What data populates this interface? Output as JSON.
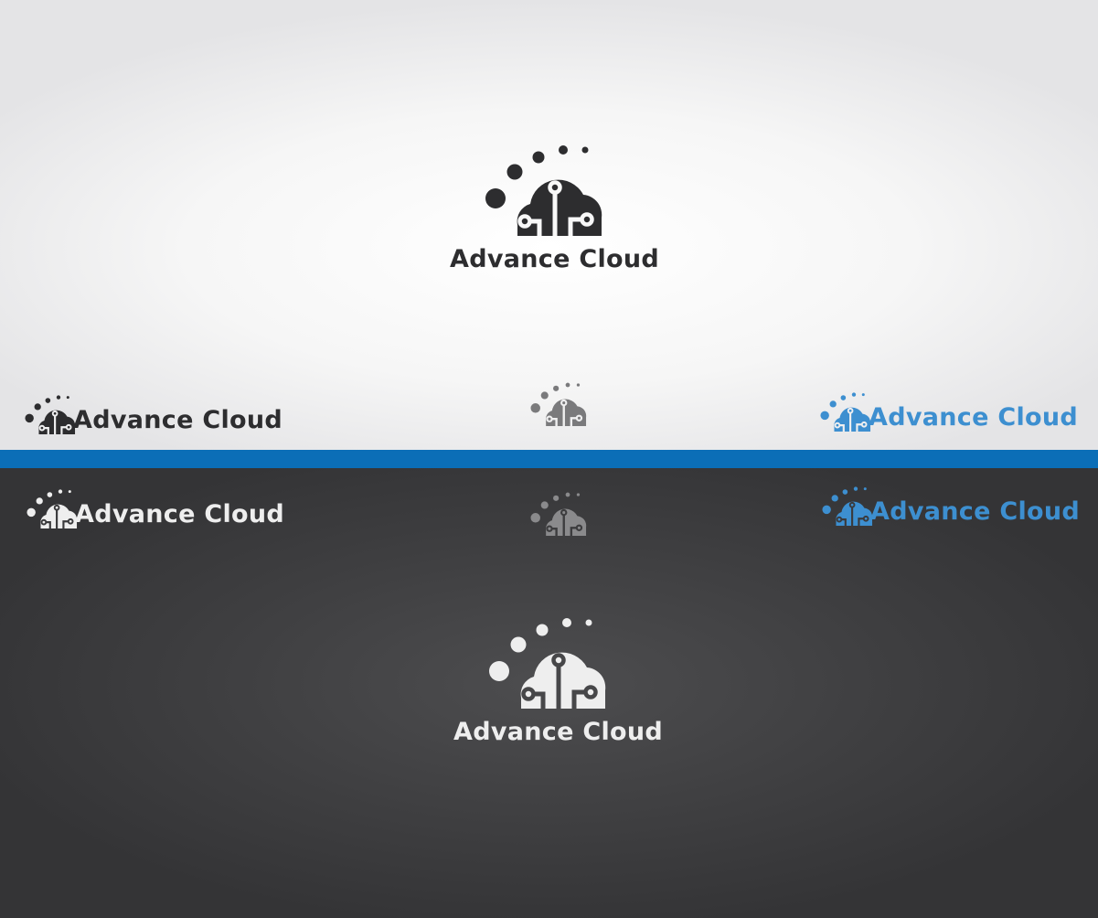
{
  "brand": {
    "name": "Advance Cloud"
  },
  "colors": {
    "dark": "#2d2d2f",
    "blue": "#3d8fd0",
    "stripe": "#0b6eb7",
    "light": "#eeeeee",
    "gray": "#7a7a7c",
    "gray_on_dark": "#8a8a8c"
  },
  "icons": {
    "logo": "cloud-circuit-icon"
  },
  "variants": [
    {
      "id": "main-light",
      "color": "#2d2d2f",
      "label": "Advance Cloud"
    },
    {
      "id": "horizontal-dark-on-light",
      "color": "#2d2d2f",
      "label": "Advance Cloud"
    },
    {
      "id": "icon-gray-on-light",
      "color": "#7a7a7c"
    },
    {
      "id": "horizontal-blue-on-light",
      "color": "#3d8fd0",
      "label": "Advance Cloud"
    },
    {
      "id": "horizontal-white-on-dark",
      "color": "#eeeeee",
      "label": "Advance Cloud"
    },
    {
      "id": "icon-gray-on-dark",
      "color": "#8a8a8c"
    },
    {
      "id": "horizontal-blue-on-dark",
      "color": "#3d8fd0",
      "label": "Advance Cloud"
    },
    {
      "id": "main-dark",
      "color": "#eeeeee",
      "label": "Advance Cloud"
    }
  ]
}
